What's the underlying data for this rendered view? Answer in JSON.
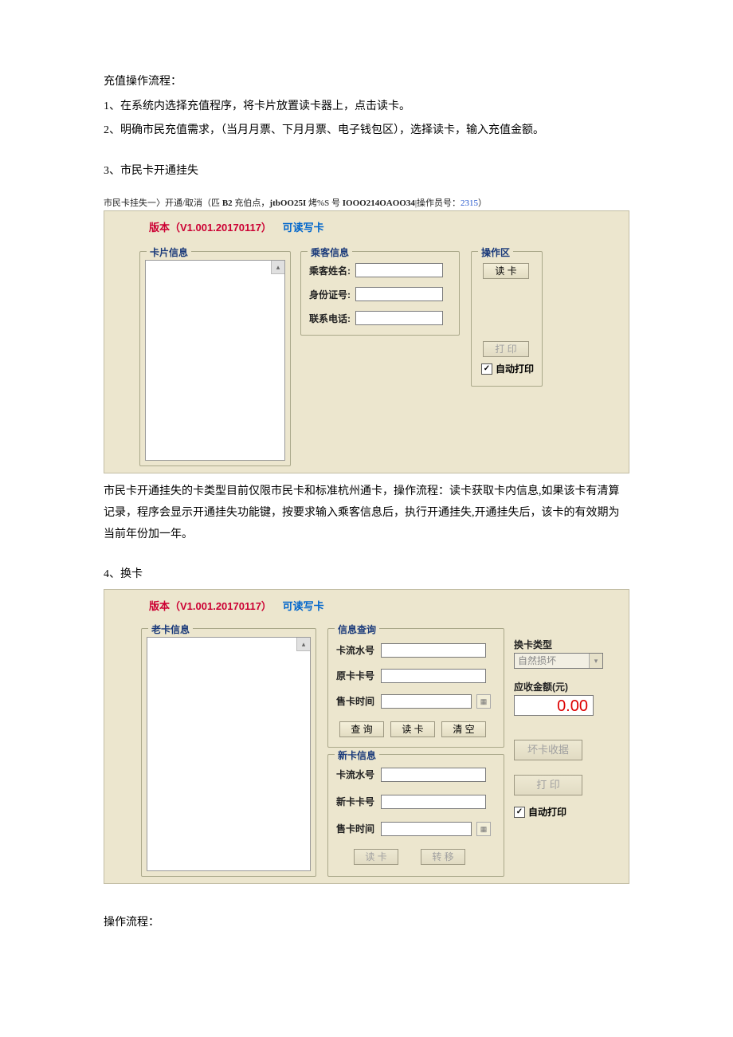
{
  "intro": {
    "title": "充值操作流程：",
    "line1": "1、在系统内选择充值程序，将卡片放置读卡器上，点击读卡。",
    "line2": "2、明确市民充值需求，（当月月票、下月月票、电子钱包区），选择读卡，输入充值金额。"
  },
  "section3": {
    "heading": "3、市民卡开通挂失",
    "caption_prefix": "市民卡挂失一〉开通/取消（匹 ",
    "caption_b2": "B2",
    "caption_mid1": " 充伯点，",
    "caption_jtb": "jtbOO25I",
    "caption_mid2": " 烤%S 号 ",
    "caption_code": "IOOO214OAOO34",
    "caption_mid3": "|操作员号：",
    "caption_op": "2315",
    "caption_end": "）",
    "version_label": "版本（V1.001.20170117）",
    "version_mode": "可读写卡",
    "fs_card": "卡片信息",
    "fs_passenger": "乘客信息",
    "fs_ops": "操作区",
    "lbl_name": "乘客姓名:",
    "lbl_id": "身份证号:",
    "lbl_phone": "联系电话:",
    "btn_read": "读 卡",
    "btn_print": "打 印",
    "chk_autoprint": "自动打印",
    "explain": "市民卡开通挂失的卡类型目前仅限市民卡和标准杭州通卡，操作流程：读卡获取卡内信息,如果该卡有清算记录，程序会显示开通挂失功能键，按要求输入乘客信息后，执行开通挂失,开通挂失后，该卡的有效期为当前年份加一年。"
  },
  "section4": {
    "heading": "4、换卡",
    "version_label": "版本（V1.001.20170117）",
    "version_mode": "可读写卡",
    "fs_oldcard": "老卡信息",
    "fs_query": "信息查询",
    "fs_newcard": "新卡信息",
    "lbl_serial": "卡流水号",
    "lbl_origcard": "原卡卡号",
    "lbl_saletime": "售卡时间",
    "lbl_newcard": "新卡卡号",
    "btn_query": "查  询",
    "btn_read": "读  卡",
    "btn_clear": "清  空",
    "btn_read2": "读  卡",
    "btn_transfer": "转  移",
    "side_type_label": "换卡类型",
    "side_type_value": "自然损坏",
    "side_amount_label": "应收金额(元)",
    "side_amount_value": "0.00",
    "btn_badreceipt": "坏卡收据",
    "btn_print": "打    印",
    "chk_autoprint": "自动打印"
  },
  "footer": {
    "heading": "操作流程："
  }
}
